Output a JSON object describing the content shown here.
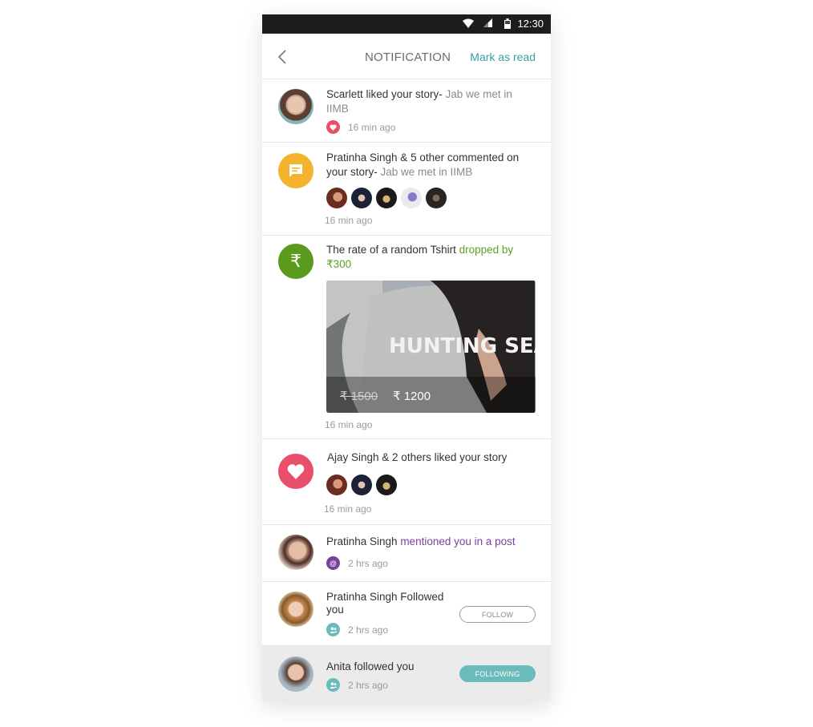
{
  "status_bar": {
    "time": "12:30"
  },
  "header": {
    "title": "NOTIFICATION",
    "mark_read": "Mark as read"
  },
  "notifications": [
    {
      "actor": "Scarlett liked your story- ",
      "story": "Jab we met in IIMB",
      "time": "16 min ago",
      "icon": "heart-icon"
    },
    {
      "actor": "Pratinha Singh & 5 other commented on your story- ",
      "story": "Jab we met in IIMB",
      "time": "16 min ago",
      "icon": "comment-icon"
    },
    {
      "text": "The rate of a random Tshirt ",
      "highlight": "dropped by ₹300",
      "product_image_text": "HUNTING SEASON",
      "old_price": "₹ 1500",
      "new_price": "₹ 1200",
      "time": "16 min ago",
      "icon": "rupee-icon"
    },
    {
      "text": "Ajay Singh & 2 others liked your story",
      "time": "16 min ago",
      "icon": "heart-icon"
    },
    {
      "actor": "Pratinha Singh ",
      "highlight": "mentioned you in a post",
      "time": "2 hrs ago",
      "icon": "at-icon"
    },
    {
      "text": "Pratinha Singh Followed you",
      "time": "2 hrs ago",
      "button": "FOLLOW",
      "icon": "people-icon"
    },
    {
      "text": "Anita followed you",
      "time": "2 hrs ago",
      "button": "FOLLOWING",
      "icon": "people-icon"
    }
  ],
  "colors": {
    "accent": "#3a9fa3",
    "heart": "#e94f6a",
    "comment": "#f3b32c",
    "rupee": "#5a9b1e",
    "mention": "#7b3f9e",
    "follow": "#6bbbbb"
  }
}
